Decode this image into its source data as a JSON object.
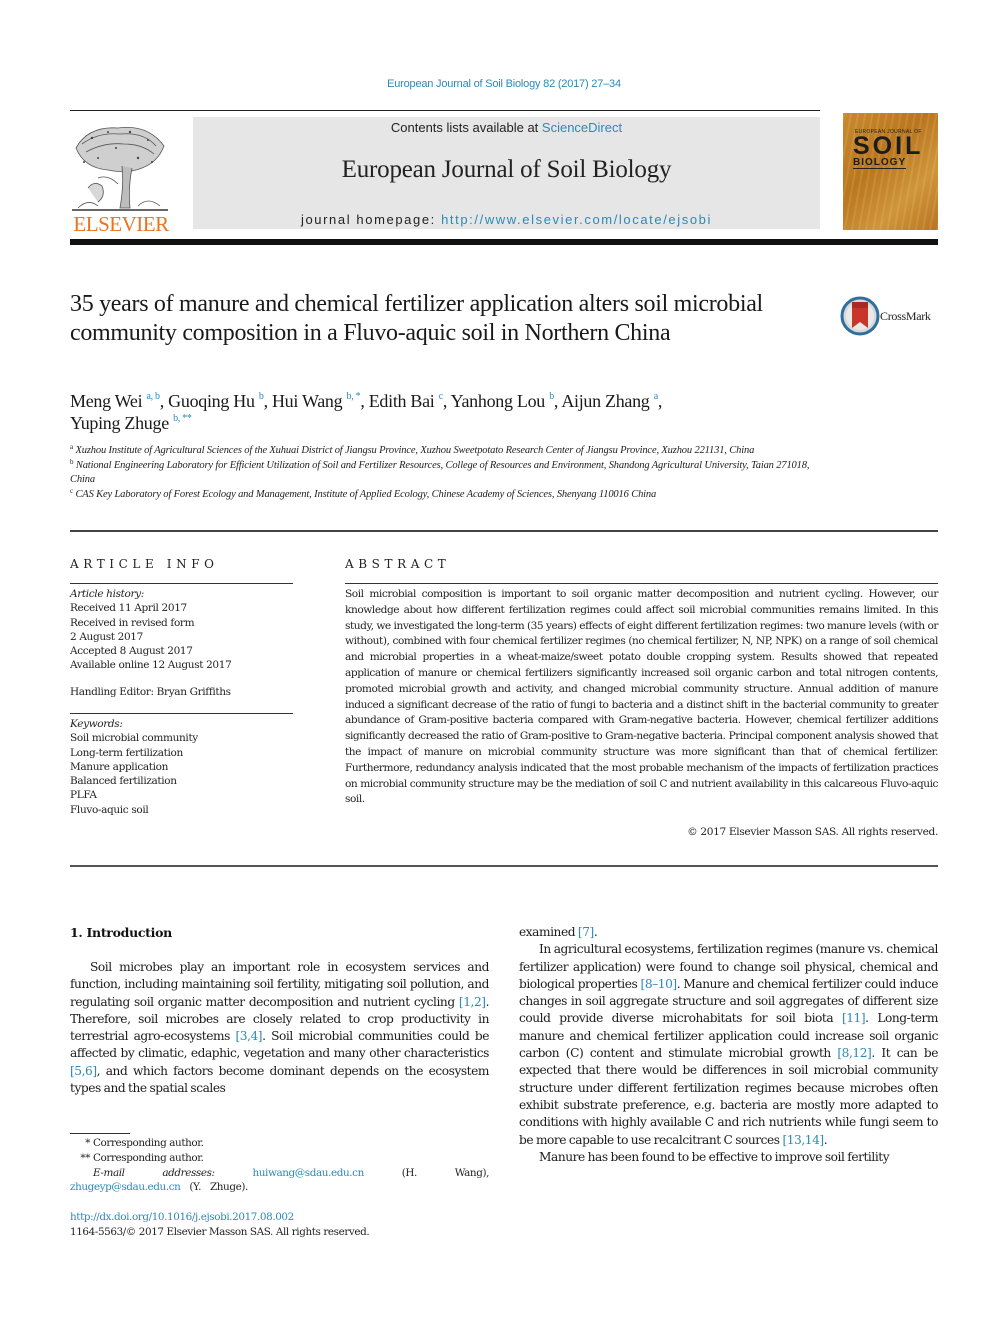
{
  "header": {
    "citation": "European Journal of Soil Biology 82 (2017) 27–34",
    "contents_prefix": "Contents lists available at ",
    "contents_link": "ScienceDirect",
    "journal_title": "European Journal of Soil Biology",
    "homepage_prefix": "journal homepage: ",
    "homepage_url": "http://www.elsevier.com/locate/ejsobi",
    "publisher_logo_text": "ELSEVIER",
    "cover": {
      "small_text": "EUROPEAN JOURNAL OF",
      "big_text": "SOIL",
      "sub_text": "BIOLOGY"
    },
    "crossmark_label": "CrossMark"
  },
  "article": {
    "title": "35 years of manure and chemical fertilizer application alters soil microbial community composition in a Fluvo-aquic soil in Northern China",
    "authors": [
      {
        "name": "Meng Wei",
        "sup": "a, b",
        "sep": ", "
      },
      {
        "name": "Guoqing Hu",
        "sup": "b",
        "sep": ", "
      },
      {
        "name": "Hui Wang",
        "sup": "b, *",
        "sep": ", "
      },
      {
        "name": "Edith Bai",
        "sup": "c",
        "sep": ", "
      },
      {
        "name": "Yanhong Lou",
        "sup": "b",
        "sep": ", "
      },
      {
        "name": "Aijun Zhang",
        "sup": "a",
        "sep": ","
      },
      {
        "name": "Yuping Zhuge",
        "sup": "b, **",
        "sep": ""
      }
    ],
    "affiliations": [
      {
        "mark": "a",
        "text": "Xuzhou Institute of Agricultural Sciences of the Xuhuai District of Jiangsu Province, Xuzhou Sweetpotato Research Center of Jiangsu Province, Xuzhou 221131, China"
      },
      {
        "mark": "b",
        "text": "National Engineering Laboratory for Efficient Utilization of Soil and Fertilizer Resources, College of Resources and Environment, Shandong Agricultural University, Taian 271018, China"
      },
      {
        "mark": "c",
        "text": "CAS Key Laboratory of Forest Ecology and Management, Institute of Applied Ecology, Chinese Academy of Sciences, Shenyang 110016 China"
      }
    ]
  },
  "article_info": {
    "heading": "ARTICLE INFO",
    "history_label": "Article history:",
    "history": [
      "Received 11 April 2017",
      "Received in revised form",
      "2 August 2017",
      "Accepted 8 August 2017",
      "Available online 12 August 2017"
    ],
    "handling_editor": "Handling Editor: Bryan Griffiths",
    "keywords_label": "Keywords:",
    "keywords": [
      "Soil microbial community",
      "Long-term fertilization",
      "Manure application",
      "Balanced fertilization",
      "PLFA",
      "Fluvo-aquic soil"
    ]
  },
  "abstract": {
    "heading": "ABSTRACT",
    "text": "Soil microbial composition is important to soil organic matter decomposition and nutrient cycling. However, our knowledge about how different fertilization regimes could affect soil microbial communities remains limited. In this study, we investigated the long-term (35 years) effects of eight different fertilization regimes: two manure levels (with or without), combined with four chemical fertilizer regimes (no chemical fertilizer, N, NP, NPK) on a range of soil chemical and microbial properties in a wheat-maize/sweet potato double cropping system. Results showed that repeated application of manure or chemical fertilizers significantly increased soil organic carbon and total nitrogen contents, promoted microbial growth and activity, and changed microbial community structure. Annual addition of manure induced a significant decrease of the ratio of fungi to bacteria and a distinct shift in the bacterial community to greater abundance of Gram-positive bacteria compared with Gram-negative bacteria. However, chemical fertilizer additions significantly decreased the ratio of Gram-positive to Gram-negative bacteria. Principal component analysis showed that the impact of manure on microbial community structure was more significant than that of chemical fertilizer. Furthermore, redundancy analysis indicated that the most probable mechanism of the impacts of fertilization practices on microbial community structure may be the mediation of soil C and nutrient availability in this calcareous Fluvo-aquic soil.",
    "copyright": "© 2017 Elsevier Masson SAS. All rights reserved."
  },
  "introduction": {
    "heading": "1.  Introduction",
    "left_paragraph": [
      {
        "t": "Soil microbes play an important role in ecosystem services and function, including maintaining soil fertility, mitigating soil pollution, and regulating soil organic matter decomposition and nutrient cycling "
      },
      {
        "ref": "[1,2]"
      },
      {
        "t": ". Therefore, soil microbes are closely related to crop productivity in terrestrial agro-ecosystems "
      },
      {
        "ref": "[3,4]"
      },
      {
        "t": ". Soil microbial communities could be affected by climatic, edaphic, vegetation and many other characteristics "
      },
      {
        "ref": "[5,6]"
      },
      {
        "t": ", and which factors become dominant depends on the ecosystem types and the spatial scales"
      }
    ],
    "right_continuation": [
      {
        "t": "examined "
      },
      {
        "ref": "[7]"
      },
      {
        "t": "."
      }
    ],
    "right_paragraph_1": [
      {
        "t": "In agricultural ecosystems, fertilization regimes (manure vs. chemical fertilizer application) were found to change soil physical, chemical and biological properties "
      },
      {
        "ref": "[8–10]"
      },
      {
        "t": ". Manure and chemical fertilizer could induce changes in soil aggregate structure and soil aggregates of different size could provide diverse microhabitats for soil biota "
      },
      {
        "ref": "[11]"
      },
      {
        "t": ". Long-term manure and chemical fertilizer application could increase soil organic carbon (C) content and stimulate microbial growth "
      },
      {
        "ref": "[8,12]"
      },
      {
        "t": ". It can be expected that there would be differences in soil microbial community structure under different fertilization regimes because microbes often exhibit substrate preference, e.g. bacteria are mostly more adapted to conditions with highly available C and rich nutrients while fungi seem to be more capable to use recalcitrant C sources "
      },
      {
        "ref": "[13,14]"
      },
      {
        "t": "."
      }
    ],
    "right_paragraph_2": "Manure has been found to be effective to improve soil fertility"
  },
  "footnotes": {
    "star1_mark": "*",
    "star1_text": "Corresponding author.",
    "star2_mark": "**",
    "star2_text": "Corresponding author.",
    "email_label": "E-mail addresses:",
    "email_1": "huiwang@sdau.edu.cn",
    "email_1_owner": "(H. Wang),",
    "email_2": "zhugeyp@sdau.edu.cn",
    "email_2_owner": "(Y. Zhuge).",
    "doi": "http://dx.doi.org/10.1016/j.ejsobi.2017.08.002",
    "issn_copyright": "1164-5563/© 2017 Elsevier Masson SAS. All rights reserved."
  },
  "colors": {
    "link": "#2a8ab8",
    "elsevier_orange": "#e8741d",
    "header_box": "#e6e6e6",
    "cover_orange": "#c98a2e"
  }
}
